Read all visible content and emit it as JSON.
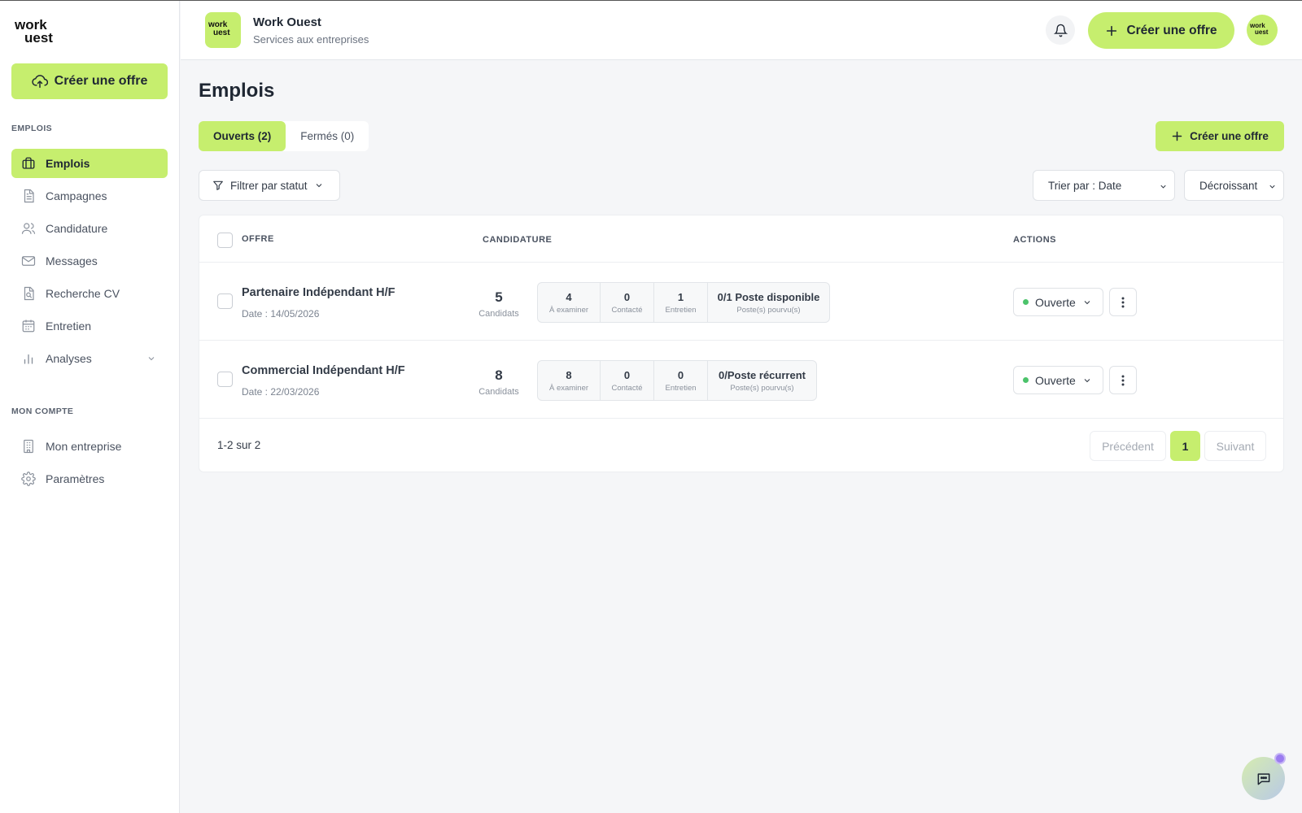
{
  "colors": {
    "accent": "#c6ee6e",
    "status_open": "#4cc36b",
    "chat_badge": "#9b7cf0"
  },
  "sidebar": {
    "logo_line1": "work",
    "logo_line2": "uest",
    "cta_label": "Créer une offre",
    "section_jobs": "EMPLOIS",
    "section_account": "MON COMPTE",
    "items": [
      {
        "label": "Emplois",
        "icon": "briefcase-icon",
        "active": true
      },
      {
        "label": "Campagnes",
        "icon": "document-icon"
      },
      {
        "label": "Candidature",
        "icon": "users-icon"
      },
      {
        "label": "Messages",
        "icon": "mail-icon"
      },
      {
        "label": "Recherche CV",
        "icon": "cv-search-icon"
      },
      {
        "label": "Entretien",
        "icon": "calendar-icon"
      },
      {
        "label": "Analyses",
        "icon": "bar-chart-icon"
      }
    ],
    "account_items": [
      {
        "label": "Mon entreprise",
        "icon": "building-icon"
      },
      {
        "label": "Paramètres",
        "icon": "gear-icon"
      }
    ]
  },
  "header": {
    "company_logo_l1": "work",
    "company_logo_l2": "uest",
    "company_name": "Work Ouest",
    "company_subtitle": "Services aux entreprises",
    "cta_label": "Créer une offre",
    "avatar_l1": "work",
    "avatar_l2": "uest"
  },
  "main": {
    "title": "Emplois",
    "tabs": [
      {
        "label": "Ouverts (2)",
        "active": true
      },
      {
        "label": "Fermés (0)",
        "active": false
      }
    ],
    "cta_label": "Créer une offre",
    "filter_label": "Filtrer par statut",
    "sort_label": "Trier par : Date",
    "order_label": "Décroissant",
    "table": {
      "headers": {
        "offer": "OFFRE",
        "applications": "CANDIDATURE",
        "actions": "ACTIONS"
      },
      "rows": [
        {
          "title": "Partenaire Indépendant H/F",
          "date": "Date : 14/05/2026",
          "candidates": "5",
          "candidates_label": "Candidats",
          "to_review": "4",
          "to_review_label": "À examiner",
          "contacted": "0",
          "contacted_label": "Contacté",
          "interview": "1",
          "interview_label": "Entretien",
          "positions": "0/1 Poste disponible",
          "positions_label": "Poste(s) pourvu(s)",
          "status": "Ouverte"
        },
        {
          "title": "Commercial Indépendant H/F",
          "date": "Date : 22/03/2026",
          "candidates": "8",
          "candidates_label": "Candidats",
          "to_review": "8",
          "to_review_label": "À examiner",
          "contacted": "0",
          "contacted_label": "Contacté",
          "interview": "0",
          "interview_label": "Entretien",
          "positions": "0/Poste récurrent",
          "positions_label": "Poste(s) pourvu(s)",
          "status": "Ouverte"
        }
      ]
    },
    "pagination": {
      "count_text": "1-2 sur 2",
      "prev": "Précédent",
      "current": "1",
      "next": "Suivant"
    }
  }
}
